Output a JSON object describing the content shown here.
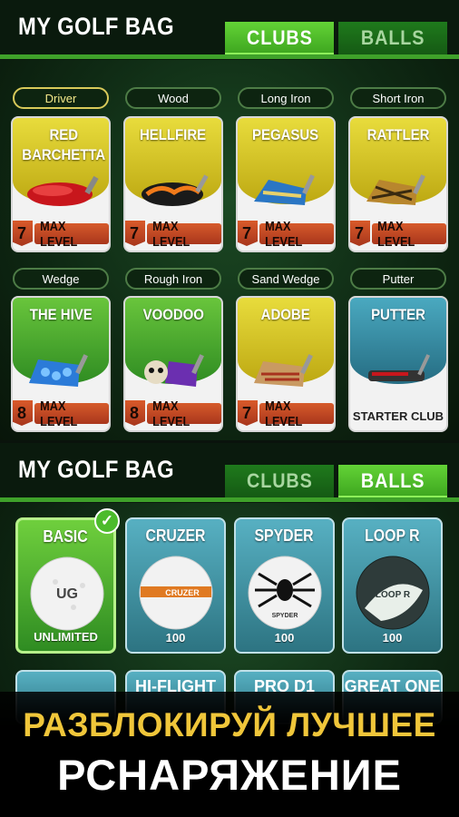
{
  "top": {
    "title": "MY GOLF BAG",
    "tabs": [
      {
        "label": "CLUBS",
        "active": true
      },
      {
        "label": "BALLS",
        "active": false
      }
    ],
    "categories": [
      "Driver",
      "Wood",
      "Long Iron",
      "Short Iron",
      "Wedge",
      "Rough Iron",
      "Sand Wedge",
      "Putter"
    ],
    "clubs": [
      {
        "name": "RED BARCHETTA",
        "level": "7",
        "status": "MAX LEVEL",
        "color": "yellow"
      },
      {
        "name": "HELLFIRE",
        "level": "7",
        "status": "MAX LEVEL",
        "color": "yellow"
      },
      {
        "name": "PEGASUS",
        "level": "7",
        "status": "MAX LEVEL",
        "color": "yellow"
      },
      {
        "name": "RATTLER",
        "level": "7",
        "status": "MAX LEVEL",
        "color": "yellow"
      },
      {
        "name": "THE HIVE",
        "level": "8",
        "status": "MAX LEVEL",
        "color": "green"
      },
      {
        "name": "VOODOO",
        "level": "8",
        "status": "MAX LEVEL",
        "color": "green"
      },
      {
        "name": "ADOBE",
        "level": "7",
        "status": "MAX LEVEL",
        "color": "yellow"
      },
      {
        "name": "PUTTER",
        "status": "STARTER CLUB",
        "color": "teal"
      }
    ]
  },
  "bottom": {
    "title": "MY GOLF BAG",
    "tabs": [
      {
        "label": "CLUBS",
        "active": false
      },
      {
        "label": "BALLS",
        "active": true
      }
    ],
    "balls": [
      {
        "name": "BASIC",
        "count": "UNLIMITED",
        "selected": true
      },
      {
        "name": "CRUZER",
        "count": "100"
      },
      {
        "name": "SPYDER",
        "count": "100"
      },
      {
        "name": "LOOP R",
        "count": "100"
      }
    ],
    "partial_balls": [
      "",
      "HI-FLIGHT",
      "PRO D1",
      "GREAT ONE"
    ]
  },
  "banner": {
    "line1": "РАЗБЛОКИРУЙ ЛУЧШЕЕ",
    "line2": "РСНАРЯЖЕНИЕ"
  },
  "colors": {
    "accent": "#3fa12a",
    "gold": "#f0c63a",
    "max_level": "#c9471f"
  }
}
